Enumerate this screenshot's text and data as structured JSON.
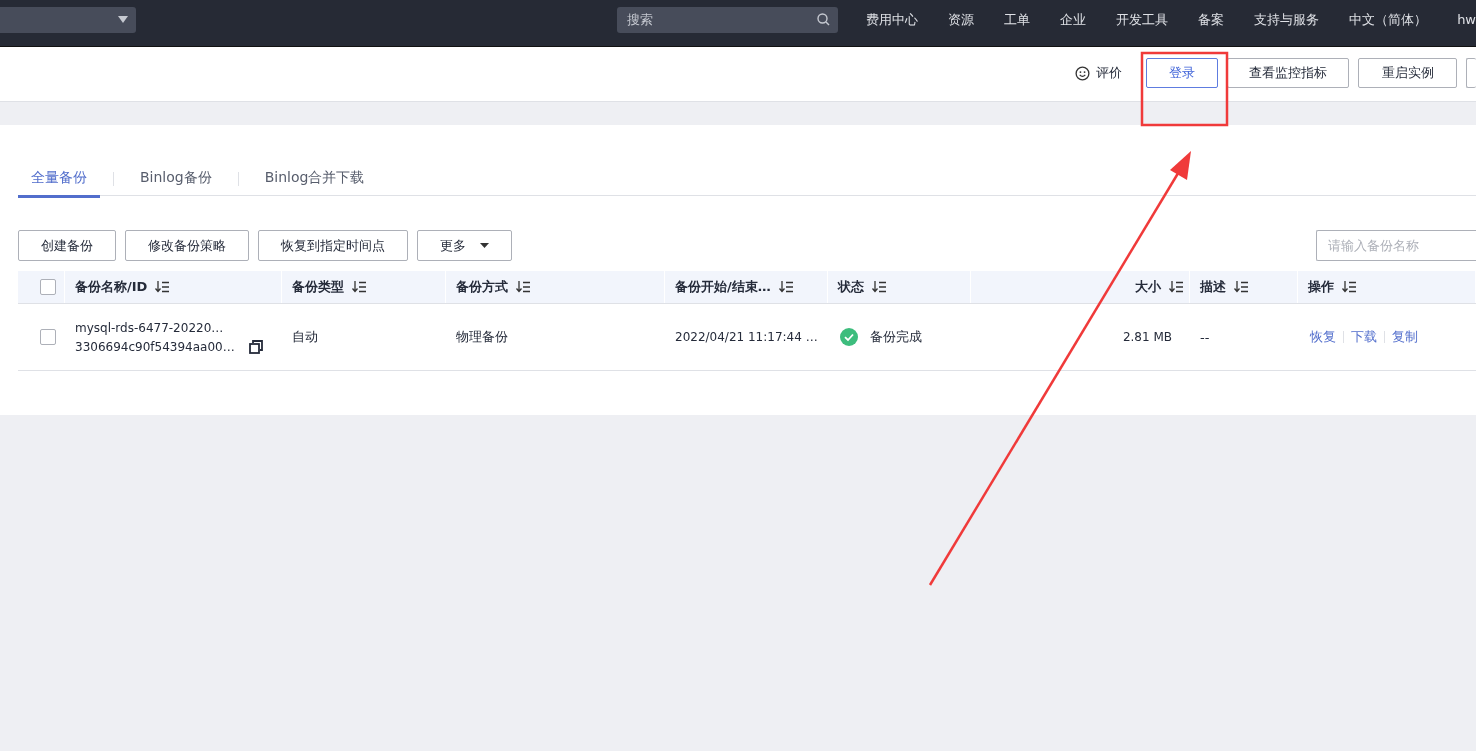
{
  "top_bar": {
    "search": {
      "placeholder": "搜索"
    },
    "nav": [
      "费用中心",
      "资源",
      "工单",
      "企业",
      "开发工具",
      "备案",
      "支持与服务",
      "中文（简体）",
      "hw"
    ]
  },
  "header": {
    "rate_label": "评价",
    "buttons": [
      {
        "label": "登录",
        "highlighted": true
      },
      {
        "label": "查看监控指标",
        "highlighted": false
      },
      {
        "label": "重启实例",
        "highlighted": false
      }
    ]
  },
  "tabs": [
    {
      "label": "全量备份",
      "selected": true
    },
    {
      "label": "Binlog备份",
      "selected": false
    },
    {
      "label": "Binlog合并下载",
      "selected": false
    }
  ],
  "toolbar": {
    "buttons": [
      {
        "label": "创建备份",
        "kind": "plain"
      },
      {
        "label": "修改备份策略",
        "kind": "plain"
      },
      {
        "label": "恢复到指定时间点",
        "kind": "plain"
      },
      {
        "label": "更多",
        "kind": "dropdown"
      }
    ],
    "search": {
      "placeholder": "请输入备份名称"
    }
  },
  "table": {
    "header_checked": false,
    "columns": [
      "备份名称/ID",
      "备份类型",
      "备份方式",
      "备份开始/结束…",
      "状态",
      "大小",
      "描述",
      "操作"
    ],
    "rows": [
      {
        "checked": false,
        "name": "mysql-rds-6477-20220…",
        "id": "3306694c90f54394aa00…",
        "type": "自动",
        "method": "物理备份",
        "start": "2022/04/21 11:17:44 …",
        "status": "备份完成",
        "size": "2.81 MB",
        "description": "--",
        "actions": [
          "恢复",
          "下载",
          "复制"
        ]
      }
    ]
  }
}
